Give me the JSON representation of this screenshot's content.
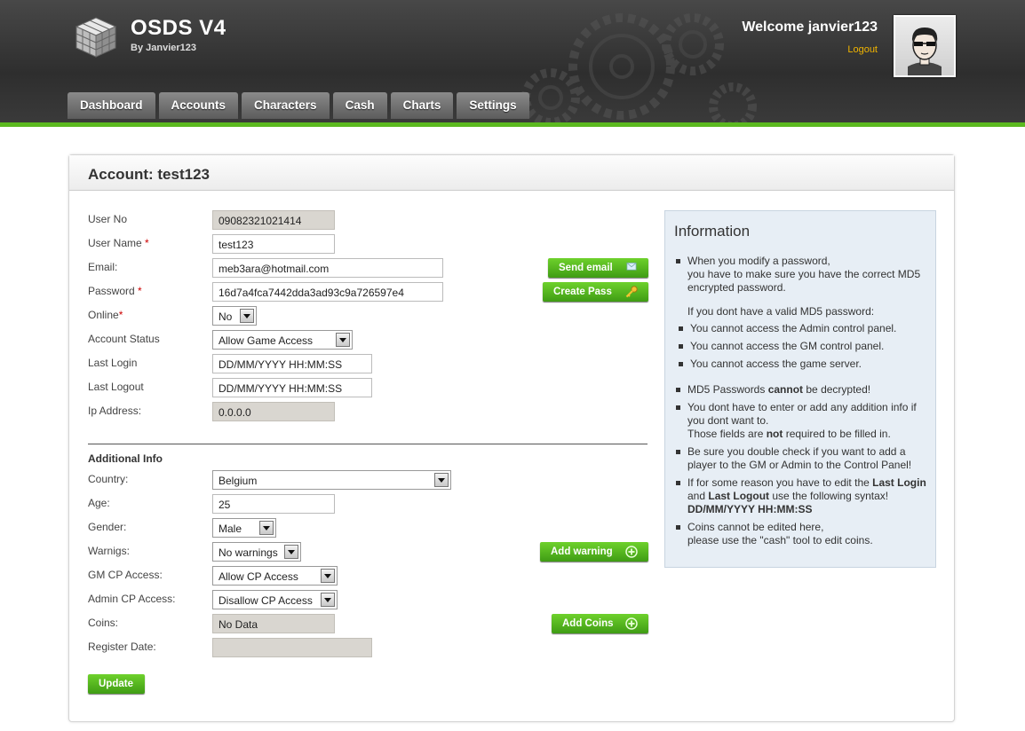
{
  "app": {
    "title": "OSDS V4",
    "subtitle": "By Janvier123"
  },
  "user": {
    "welcome": "Welcome janvier123",
    "logout": "Logout"
  },
  "nav": [
    "Dashboard",
    "Accounts",
    "Characters",
    "Cash",
    "Charts",
    "Settings"
  ],
  "page_title": "Account: test123",
  "form": {
    "user_no": {
      "label": "User No",
      "value": "09082321021414"
    },
    "user_name": {
      "label": "User Name",
      "value": "test123"
    },
    "email": {
      "label": "Email:",
      "value": "meb3ara@hotmail.com"
    },
    "password": {
      "label": "Password",
      "value": "16d7a4fca7442dda3ad93c9a726597e4"
    },
    "online": {
      "label": "Online",
      "value": "No"
    },
    "account_status": {
      "label": "Account Status",
      "value": "Allow Game Access"
    },
    "last_login": {
      "label": "Last Login",
      "value": "DD/MM/YYYY HH:MM:SS"
    },
    "last_logout": {
      "label": "Last Logout",
      "value": "DD/MM/YYYY HH:MM:SS"
    },
    "ip_address": {
      "label": "Ip Address:",
      "value": "0.0.0.0"
    },
    "required_marker": "*"
  },
  "buttons": {
    "send_email": "Send email",
    "create_pass": "Create Pass",
    "add_warning": "Add warning",
    "add_coins": "Add Coins",
    "update": "Update"
  },
  "additional": {
    "heading": "Additional Info",
    "country": {
      "label": "Country:",
      "value": "Belgium"
    },
    "age": {
      "label": "Age:",
      "value": "25"
    },
    "gender": {
      "label": "Gender:",
      "value": "Male"
    },
    "warnings": {
      "label": "Warnigs:",
      "value": "No warnings"
    },
    "gm_cp": {
      "label": "GM CP Access:",
      "value": "Allow CP Access"
    },
    "admin_cp": {
      "label": "Admin CP Access:",
      "value": "Disallow CP Access"
    },
    "coins": {
      "label": "Coins:",
      "value": "No Data"
    },
    "register_date": {
      "label": "Register Date:",
      "value": ""
    }
  },
  "info": {
    "heading": "Information",
    "item1_l1": "When you modify a password,",
    "item1_l2": "you have to make sure you have the correct MD5 encrypted password.",
    "no_valid": "If you dont have a valid MD5 password:",
    "sub1": "You cannot access the Admin control panel.",
    "sub2": "You cannot access the GM control panel.",
    "sub3": "You cannot access the game server.",
    "md5_a": "MD5 Passwords ",
    "md5_b": "cannot",
    "md5_c": " be decrypted!",
    "extra_a": "You dont have to enter or add any addition info if you dont want to.",
    "extra_b": "Those fields are ",
    "extra_c": "not",
    "extra_d": " required to be filled in.",
    "doublecheck": "Be sure you double check if you want to add a player to the GM or Admin to the Control Panel!",
    "edit_a": "If for some reason you have to edit the ",
    "edit_b": "Last Login",
    "edit_c": " and ",
    "edit_d": "Last Logout",
    "edit_e": " use the following syntax! ",
    "edit_f": "DD/MM/YYYY HH:MM:SS",
    "coins_a": "Coins cannot be edited here,",
    "coins_b": "please use the \"cash\" tool to edit coins."
  }
}
